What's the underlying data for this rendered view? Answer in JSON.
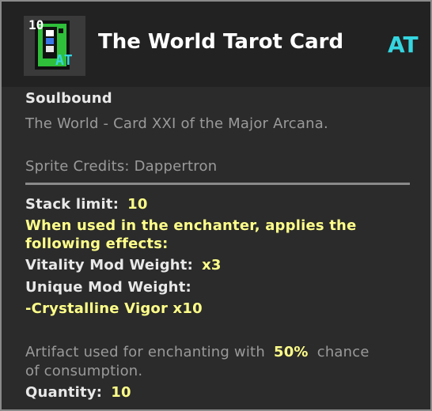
{
  "item": {
    "stack_count": "10",
    "icon_badge": "AT",
    "name": "The World Tarot Card",
    "mod_tag": "AT"
  },
  "tooltip": {
    "binding": "Soulbound",
    "description": "The World - Card XXI of the Major Arcana.",
    "credits": "Sprite Credits: Dappertron",
    "stack_limit_label": "Stack limit:",
    "stack_limit_value": "10",
    "enchanter_line1": "When used in the enchanter, applies the",
    "enchanter_line2": "following effects:",
    "vitality_label": "Vitality Mod Weight:",
    "vitality_value": "x3",
    "unique_label": "Unique Mod Weight:",
    "unique_entry": "-Crystalline Vigor x10",
    "artifact_prefix": "Artifact used for enchanting with",
    "artifact_percent": "50%",
    "artifact_suffix": "chance",
    "artifact_line2": "of consumption.",
    "quantity_label": "Quantity:",
    "quantity_value": "10"
  },
  "colors": {
    "background": "#2b2b2b",
    "header": "#222222",
    "border": "#8a8a8a",
    "accent_cyan": "#35d6e0",
    "highlight_yellow": "#ffff8a",
    "muted_grey": "#9a9a9a"
  },
  "icons": [
    "tarot-card-icon"
  ]
}
